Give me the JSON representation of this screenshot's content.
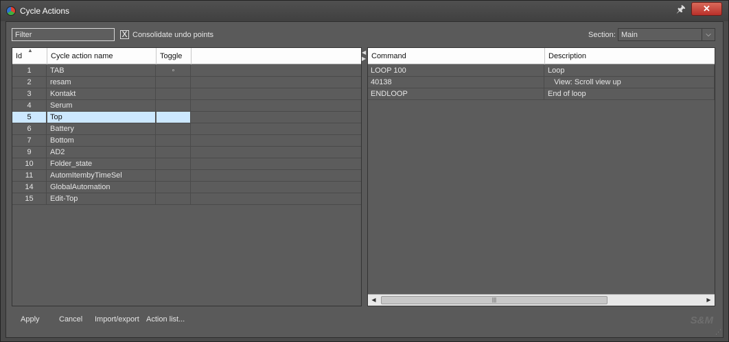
{
  "window": {
    "title": "Cycle Actions",
    "icons": {
      "app": "reaper-icon",
      "pin": "pin-icon",
      "close": "close-icon"
    },
    "pin_glyph": "🖈",
    "close_glyph": "✕"
  },
  "toolbar": {
    "filter_placeholder": "Filter",
    "consolidate_label": "Consolidate undo points",
    "consolidate_checked": true,
    "consolidate_mark": "X",
    "section_label": "Section:",
    "section_value": "Main",
    "section_arrow": "⌵"
  },
  "left_table": {
    "columns": [
      "Id",
      "Cycle action name",
      "Toggle"
    ],
    "rows": [
      {
        "id": "1",
        "name": "TAB",
        "toggle": "◦"
      },
      {
        "id": "2",
        "name": "resam",
        "toggle": ""
      },
      {
        "id": "3",
        "name": "Kontakt",
        "toggle": ""
      },
      {
        "id": "4",
        "name": "Serum",
        "toggle": ""
      },
      {
        "id": "5",
        "name": "Top",
        "toggle": "",
        "selected": true
      },
      {
        "id": "6",
        "name": "Battery",
        "toggle": ""
      },
      {
        "id": "7",
        "name": "Bottom",
        "toggle": ""
      },
      {
        "id": "9",
        "name": "AD2",
        "toggle": ""
      },
      {
        "id": "10",
        "name": "Folder_state",
        "toggle": ""
      },
      {
        "id": "11",
        "name": "AutomItembyTimeSel",
        "toggle": ""
      },
      {
        "id": "14",
        "name": "GlobalAutomation",
        "toggle": ""
      },
      {
        "id": "15",
        "name": "Edit-Top",
        "toggle": ""
      }
    ]
  },
  "right_table": {
    "columns": [
      "Command",
      "Description"
    ],
    "rows": [
      {
        "command": "LOOP 100",
        "description": "Loop"
      },
      {
        "command": "40138",
        "description": "   View: Scroll view up"
      },
      {
        "command": "ENDLOOP",
        "description": "End of loop"
      }
    ]
  },
  "buttons": {
    "apply": "Apply",
    "cancel": "Cancel",
    "import_export": "Import/export",
    "action_list": "Action list..."
  },
  "branding": {
    "logo": "S&M"
  },
  "colors": {
    "selection": "#cce8ff",
    "close": "#c9453a"
  }
}
